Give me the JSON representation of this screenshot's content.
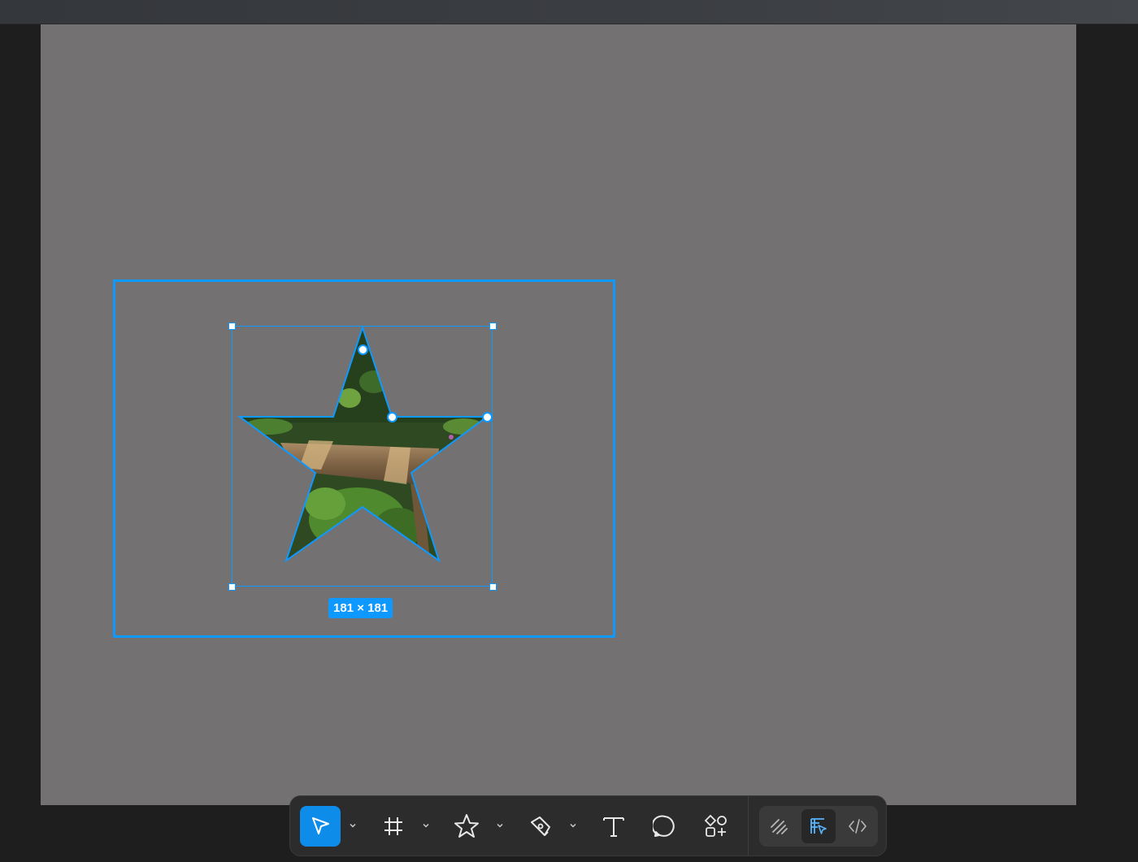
{
  "colors": {
    "selection": "#0d99ff",
    "artboard": "#737172",
    "background": "#1e1e1e",
    "toolbar": "#2c2c2c",
    "active_tool": "#0d8ce9"
  },
  "canvas": {
    "selection_size_label": "181 × 181",
    "selected_shape": "star"
  },
  "toolbar": {
    "tools": [
      {
        "name": "move",
        "icon": "cursor-icon",
        "active": true,
        "has_menu": true
      },
      {
        "name": "frame",
        "icon": "frame-icon",
        "active": false,
        "has_menu": true
      },
      {
        "name": "shape",
        "icon": "star-icon",
        "active": false,
        "has_menu": true
      },
      {
        "name": "pen",
        "icon": "pen-icon",
        "active": false,
        "has_menu": true
      },
      {
        "name": "text",
        "icon": "text-icon",
        "active": false,
        "has_menu": false
      },
      {
        "name": "comment",
        "icon": "comment-icon",
        "active": false,
        "has_menu": false
      },
      {
        "name": "actions",
        "icon": "shapes-plus-icon",
        "active": false,
        "has_menu": false
      }
    ],
    "modes": [
      {
        "name": "draw",
        "icon": "draw-icon",
        "active": false
      },
      {
        "name": "design",
        "icon": "design-icon",
        "active": true
      },
      {
        "name": "dev",
        "icon": "code-icon",
        "active": false
      }
    ]
  }
}
